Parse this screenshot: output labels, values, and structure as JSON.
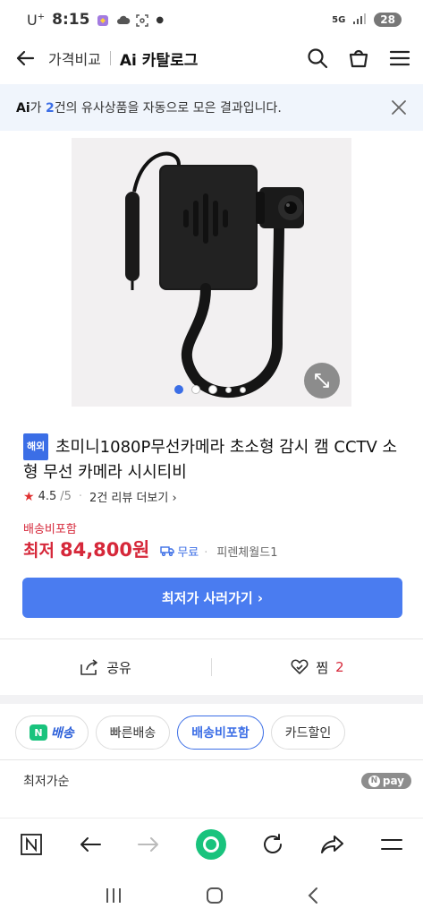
{
  "status_bar": {
    "carrier": "U",
    "carrier_sup": "+",
    "time": "8:15",
    "network": "5G",
    "battery": "28"
  },
  "header": {
    "section": "가격비교",
    "title": "Ai 카탈로그"
  },
  "ai_banner": {
    "mark": "Ai",
    "text_a": "가 ",
    "count": "2",
    "text_b": "건의 유사상품을 자동으로 모은 결과입니다."
  },
  "product": {
    "badge": "해외",
    "title": "초미니1080P무선카메라 초소형 감시 캠 CCTV 소형 무선 카메라 시시티비",
    "rating": "4.5",
    "rating_max": "/5",
    "reviews": "2건 리뷰 더보기",
    "shipping_included": "배송비포함",
    "price_label": "최저",
    "price": "84,800원",
    "free": "무료",
    "seller": "피렌체월드1",
    "cta": "최저가 사러가기"
  },
  "image_dots": {
    "count": 5,
    "active_index": 0
  },
  "actions": {
    "share": "공유",
    "zzim": "찜",
    "zzim_count": "2"
  },
  "filters": [
    {
      "label": "배송",
      "prefix": "N",
      "active": false
    },
    {
      "label": "빠른배송",
      "active": false
    },
    {
      "label": "배송비포함",
      "active": true
    },
    {
      "label": "카드할인",
      "active": false
    }
  ],
  "sort": {
    "label": "최저가순",
    "npay": "pay"
  },
  "colors": {
    "accent": "#4a7cf0",
    "price": "#d6283a",
    "naver_green": "#19c37d",
    "banner_bg": "#f0f5fc"
  }
}
